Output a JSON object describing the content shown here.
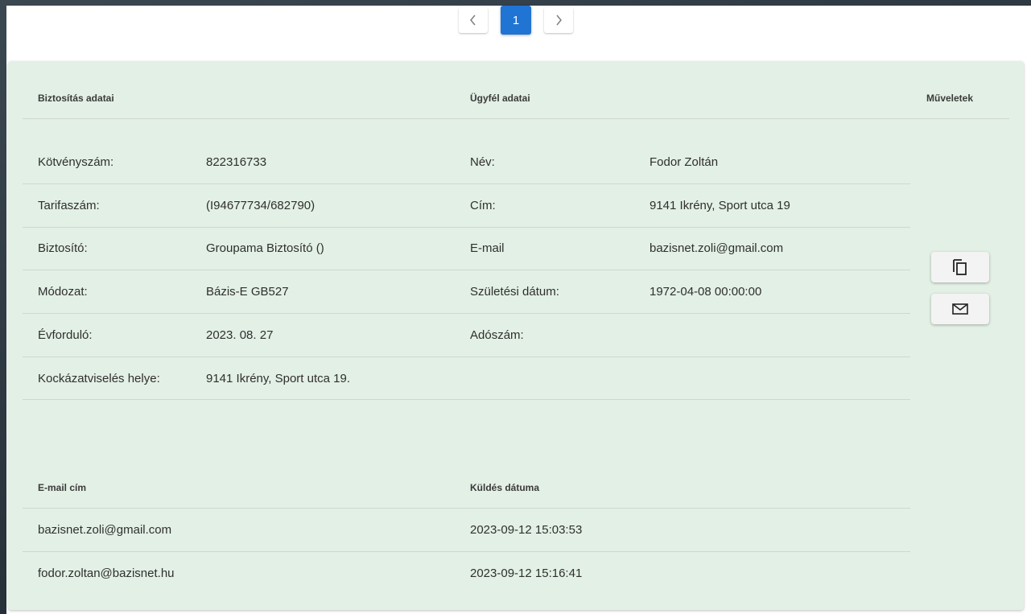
{
  "pagination": {
    "current_page": "1"
  },
  "details": {
    "headers": {
      "insurance": "Biztosítás adatai",
      "client": "Ügyfél adatai",
      "actions": "Műveletek"
    },
    "insurance_rows": [
      {
        "label": "Kötvényszám:",
        "value": "822316733"
      },
      {
        "label": "Tarifaszám:",
        "value": "(I94677734/682790)"
      },
      {
        "label": "Biztosító:",
        "value": "Groupama Biztosító ()"
      },
      {
        "label": "Módozat:",
        "value": "Bázis-E GB527"
      },
      {
        "label": "Évforduló:",
        "value": "2023. 08. 27"
      },
      {
        "label": "Kockázatviselés helye:",
        "value": "9141 Ikrény, Sport utca 19."
      }
    ],
    "client_rows": [
      {
        "label": "Név:",
        "value": "Fodor Zoltán"
      },
      {
        "label": "Cím:",
        "value": "9141 Ikrény, Sport utca 19"
      },
      {
        "label": "E-mail",
        "value": "bazisnet.zoli@gmail.com"
      },
      {
        "label": "Születési dátum:",
        "value": "1972-04-08 00:00:00"
      },
      {
        "label": "Adószám:",
        "value": ""
      }
    ],
    "action_icons": [
      "copy-icon",
      "mail-icon"
    ]
  },
  "emails": {
    "headers": {
      "email": "E-mail cím",
      "sent": "Küldés dátuma"
    },
    "rows": [
      {
        "email": "bazisnet.zoli@gmail.com",
        "sent": "2023-09-12 15:03:53"
      },
      {
        "email": "fodor.zoltan@bazisnet.hu",
        "sent": "2023-09-12 15:16:41"
      }
    ]
  }
}
